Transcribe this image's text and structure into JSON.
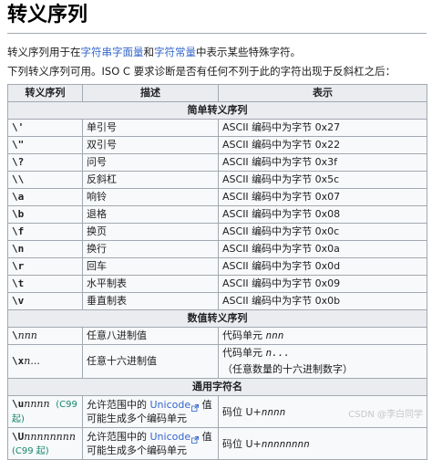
{
  "title": "转义序列",
  "intro": {
    "before": "转义序列用于在",
    "link1": "字符串字面量",
    "middle": "和",
    "link2": "字符常量",
    "after": "中表示某些特殊字符。"
  },
  "note": "下列转义序列可用。ISO C 要求诊断是否有任何不列于此的字符出现于反斜杠之后：",
  "table": {
    "headers": [
      "转义序列",
      "描述",
      "表示"
    ],
    "sections": {
      "simple": "简单转义序列",
      "numeric": "数值转义序列",
      "universal": "通用字符名"
    },
    "simple_rows": [
      {
        "seq": "\\'",
        "desc": "单引号",
        "rep": "ASCII 编码中为字节 0x27"
      },
      {
        "seq": "\\\"",
        "desc": "双引号",
        "rep": "ASCII 编码中为字节 0x22"
      },
      {
        "seq": "\\?",
        "desc": "问号",
        "rep": "ASCII 编码中为字节 0x3f"
      },
      {
        "seq": "\\\\",
        "desc": "反斜杠",
        "rep": "ASCII 编码中为字节 0x5c"
      },
      {
        "seq": "\\a",
        "desc": "响铃",
        "rep": "ASCII 编码中为字节 0x07"
      },
      {
        "seq": "\\b",
        "desc": "退格",
        "rep": "ASCII 编码中为字节 0x08"
      },
      {
        "seq": "\\f",
        "desc": "换页",
        "rep": "ASCII 编码中为字节 0x0c"
      },
      {
        "seq": "\\n",
        "desc": "换行",
        "rep": "ASCII 编码中为字节 0x0a"
      },
      {
        "seq": "\\r",
        "desc": "回车",
        "rep": "ASCII 编码中为字节 0x0d"
      },
      {
        "seq": "\\t",
        "desc": "水平制表",
        "rep": "ASCII 编码中为字节 0x09"
      },
      {
        "seq": "\\v",
        "desc": "垂直制表",
        "rep": "ASCII 编码中为字节 0x0b"
      }
    ],
    "numeric_rows": [
      {
        "seq": "\\",
        "seq_var": "nnn",
        "desc": "任意八进制值",
        "rep": "代码单元 ",
        "rep_var": "nnn"
      },
      {
        "seq": "\\x",
        "seq_var": "n...",
        "desc": "任意十六进制值",
        "rep": "代码单元 ",
        "rep_var": "n...",
        "rep_tail": " （任意数量的十六进制数字）"
      }
    ],
    "universal_rows": [
      {
        "seq": "\\u",
        "seq_var": "nnnn",
        "c99": "(C99 起)",
        "desc_before": "允许范围中的 ",
        "desc_link": "Unicode",
        "desc_after": " 值",
        "desc_line2": "可能生成多个编码单元",
        "rep": "码位 U+",
        "rep_var": "nnnn"
      },
      {
        "seq": "\\U",
        "seq_var": "nnnnnnnn",
        "c99": "(C99 起)",
        "desc_before": "允许范围中的 ",
        "desc_link": "Unicode",
        "desc_after": " 值",
        "desc_line2": "可能生成多个编码单元",
        "rep": "码位 U+",
        "rep_var": "nnnnnnnn"
      }
    ]
  },
  "watermark": "CSDN @李白同学",
  "icons": {
    "external_link": "external-link-icon"
  },
  "colors": {
    "link": "#3366cc",
    "c99": "#14866d",
    "header_bg": "#eaecf0",
    "cell_bg": "#f8f9fa",
    "border": "#a2a9b1"
  }
}
